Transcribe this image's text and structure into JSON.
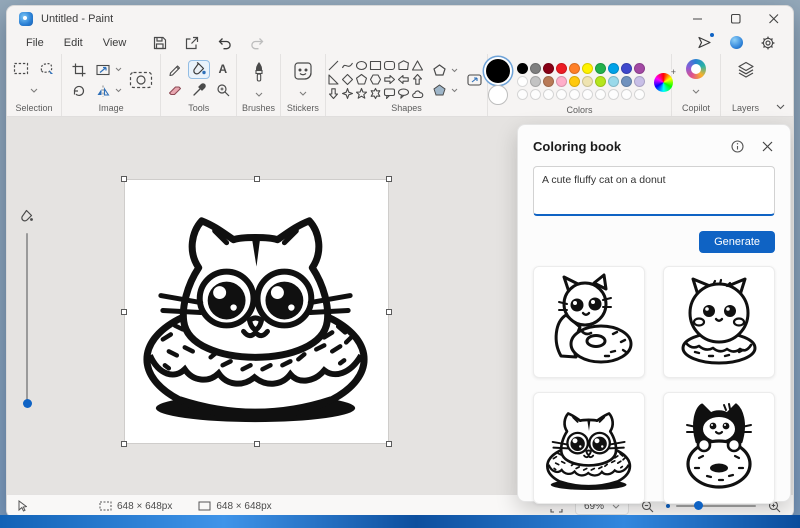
{
  "window": {
    "title": "Untitled - Paint"
  },
  "menubar": {
    "items": [
      "File",
      "Edit",
      "View"
    ]
  },
  "ribbon": {
    "labels": {
      "selection": "Selection",
      "image": "Image",
      "tools": "Tools",
      "brushes": "Brushes",
      "stickers": "Stickers",
      "shapes": "Shapes",
      "colors": "Colors",
      "copilot": "Copilot",
      "layers": "Layers"
    },
    "text_tool_char": "A"
  },
  "colors": {
    "primary": "#000000",
    "secondary": "#FFFFFF",
    "palette_row1": [
      "#000000",
      "#7F7F7F",
      "#880015",
      "#ED1C24",
      "#FF7F27",
      "#FFF200",
      "#22B14C",
      "#00A2E8",
      "#3F48CC",
      "#A349A4"
    ],
    "palette_row2": [
      "#FFFFFF",
      "#C3C3C3",
      "#B97A57",
      "#FFAEC9",
      "#FFC90E",
      "#EFE4B0",
      "#B5E61D",
      "#99D9EA",
      "#7092BE",
      "#C8BFE7"
    ],
    "empty_slots": 10
  },
  "panel": {
    "title": "Coloring book",
    "prompt": "A cute fluffy cat on a donut",
    "generate_label": "Generate",
    "thumbnails": [
      "cat-hugging-donut",
      "fluffy-cat-on-donut",
      "cat-inside-donut",
      "tuxedo-cat-behind-donut"
    ]
  },
  "statusbar": {
    "selection_size": "648 × 648px",
    "canvas_size": "648 × 648px",
    "zoom_level": "69%"
  },
  "theme": {
    "accent": "#0F63C4",
    "canvas_bg": "#E5E3E1"
  },
  "icons": {
    "chevron_down": "⌄",
    "minimize": "–",
    "multiply_close": "✕"
  }
}
